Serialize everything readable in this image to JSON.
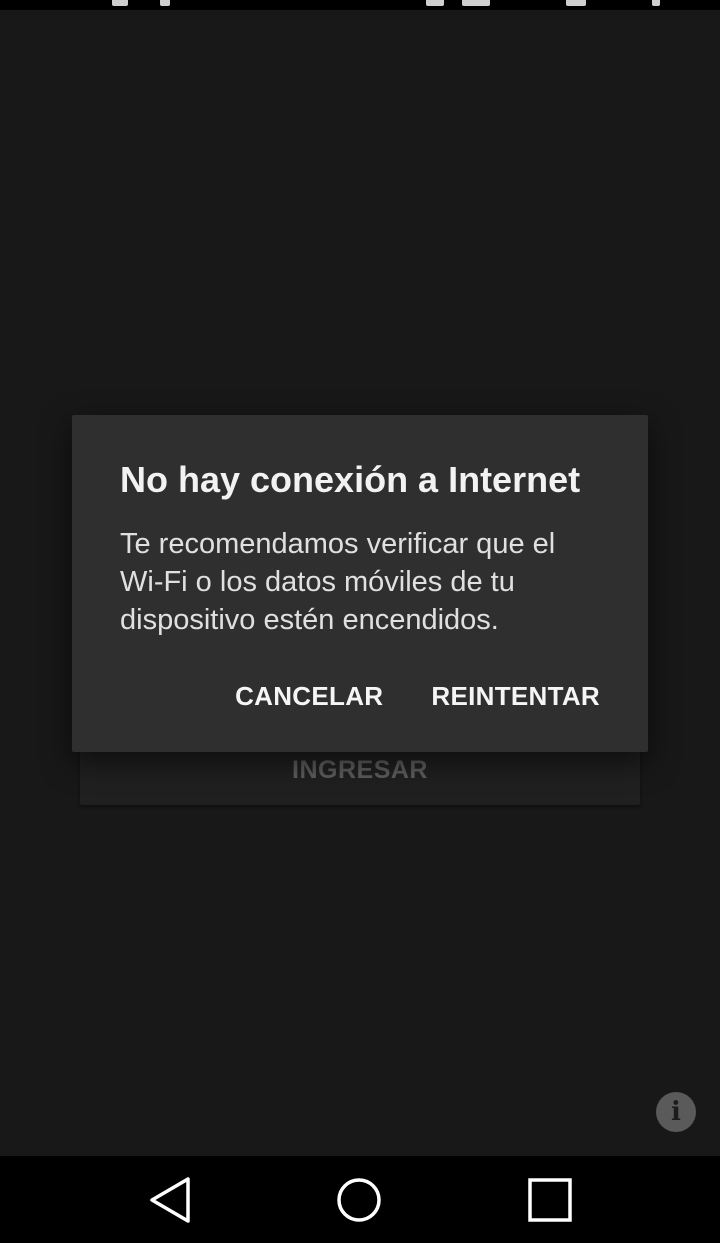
{
  "dialog": {
    "title": "No hay conexión a Internet",
    "message": "Te recomendamos verificar que el Wi-Fi o los datos móviles de tu dispositivo estén encendidos.",
    "cancel_label": "CANCELAR",
    "retry_label": "REINTENTAR"
  },
  "login": {
    "button_label": "INGRESAR"
  },
  "info_button": {
    "icon": "info-icon",
    "glyph": "i"
  },
  "nav_bar": {
    "back_icon": "back-triangle-icon",
    "home_icon": "home-circle-icon",
    "recents_icon": "recents-square-icon"
  },
  "colors": {
    "background": "#181818",
    "dialog_background": "#2f2f2f",
    "nav_background": "#000000"
  }
}
